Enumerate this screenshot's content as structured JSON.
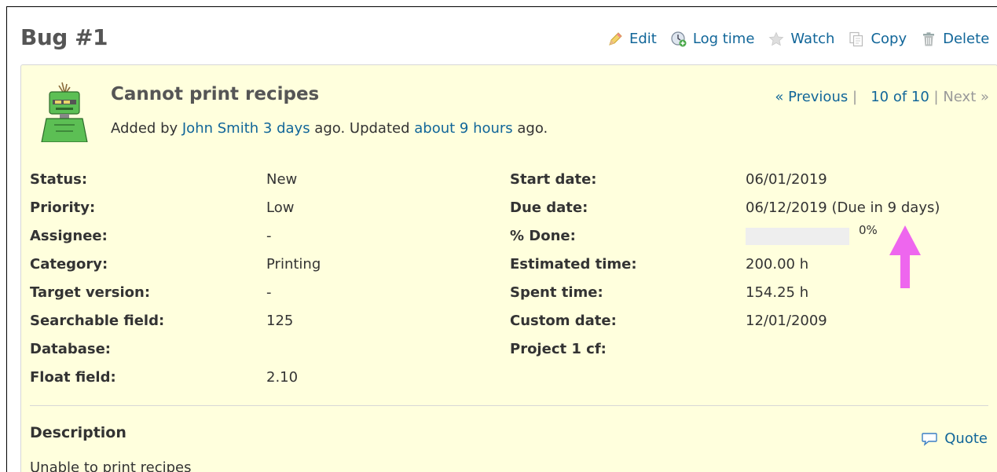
{
  "issue": {
    "title": "Bug #1",
    "subject": "Cannot print recipes",
    "added_by_prefix": "Added by ",
    "author": "John Smith",
    "created_ago": "3 days",
    "updated_mid": " ago. Updated ",
    "updated_ago": "about 9 hours",
    "updated_suffix": " ago."
  },
  "actions": [
    {
      "label": "Edit",
      "icon": "pencil-icon"
    },
    {
      "label": "Log time",
      "icon": "clock-icon"
    },
    {
      "label": "Watch",
      "icon": "star-icon"
    },
    {
      "label": "Copy",
      "icon": "copy-icon"
    },
    {
      "label": "Delete",
      "icon": "trash-icon"
    }
  ],
  "nav": {
    "previous": "« Previous",
    "sep1": " | ",
    "position": "10 of 10",
    "sep2": " | ",
    "next": "Next »"
  },
  "attributes_left": [
    {
      "label": "Status:",
      "value": "New"
    },
    {
      "label": "Priority:",
      "value": "Low"
    },
    {
      "label": "Assignee:",
      "value": "-"
    },
    {
      "label": "Category:",
      "value": "Printing"
    },
    {
      "label": "Target version:",
      "value": "-"
    },
    {
      "label": "Searchable field:",
      "value": "125"
    },
    {
      "label": "Database:",
      "value": ""
    },
    {
      "label": "Float field:",
      "value": "2.10"
    }
  ],
  "attributes_right": [
    {
      "label": "Start date:",
      "value": "06/01/2019"
    },
    {
      "label": "Due date:",
      "value": "06/12/2019 (Due in 9 days)"
    },
    {
      "label": "% Done:",
      "value": "0%"
    },
    {
      "label": "Estimated time:",
      "value": "200.00 h"
    },
    {
      "label": "Spent time:",
      "value": "154.25 h"
    },
    {
      "label": "Custom date:",
      "value": "12/01/2009"
    },
    {
      "label": "Project 1 cf:",
      "value": ""
    }
  ],
  "done_ratio": 0,
  "description": {
    "heading": "Description",
    "quote": "Quote",
    "text": "Unable to print recipes"
  },
  "colors": {
    "link": "#116699",
    "card_bg": "#ffffdd",
    "arrow": "#ee66ee"
  }
}
